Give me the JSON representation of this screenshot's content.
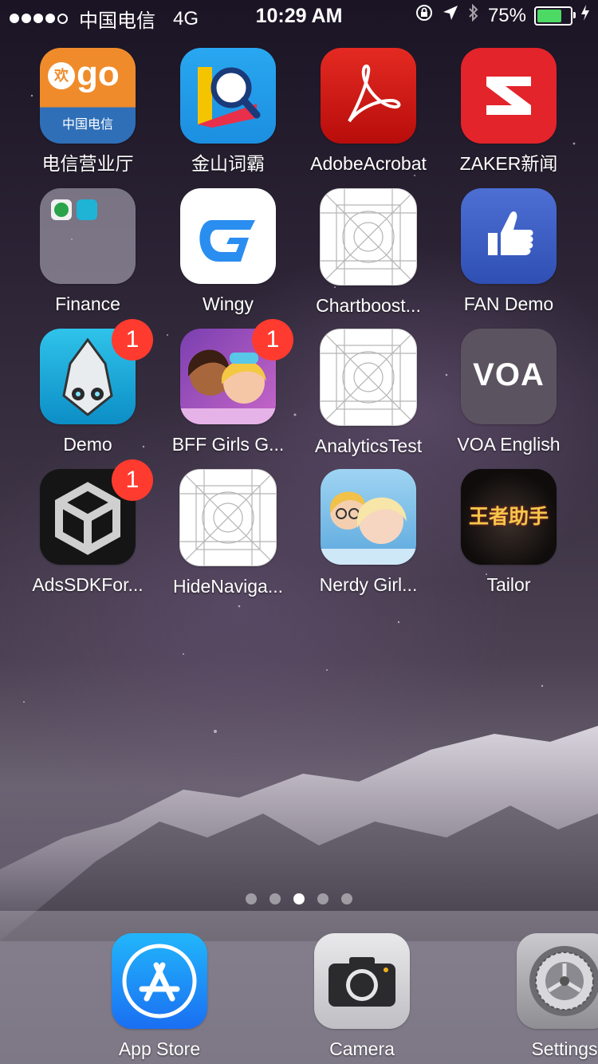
{
  "status_bar": {
    "carrier": "中国电信",
    "network": "4G",
    "time": "10:29 AM",
    "battery_percent": "75%",
    "battery_level": 0.75,
    "signal_bars": 4,
    "signal_total": 5
  },
  "apps": [
    {
      "label": "电信营业厅"
    },
    {
      "label": "金山词霸"
    },
    {
      "label": "AdobeAcrobat"
    },
    {
      "label": "ZAKER新闻"
    },
    {
      "label": "Finance"
    },
    {
      "label": "Wingy"
    },
    {
      "label": "Chartboost..."
    },
    {
      "label": "FAN Demo"
    },
    {
      "label": "Demo",
      "badge": "1"
    },
    {
      "label": "BFF Girls G...",
      "badge": "1"
    },
    {
      "label": "AnalyticsTest"
    },
    {
      "label": "VOA English",
      "icon_text": "VOA"
    },
    {
      "label": "AdsSDKFor...",
      "badge": "1"
    },
    {
      "label": "HideNaviga..."
    },
    {
      "label": "Nerdy Girl..."
    },
    {
      "label": "Tailor",
      "icon_text": "王者助手"
    }
  ],
  "app_icons": {
    "telecom_icon_text": "go",
    "telecom_brand": "中国电信"
  },
  "page_indicator": {
    "count": 5,
    "active_index": 2
  },
  "dock": [
    {
      "label": "App Store"
    },
    {
      "label": "Camera"
    },
    {
      "label": "Settings"
    }
  ],
  "colors": {
    "badge": "#ff3b30",
    "battery": "#4cd964"
  }
}
